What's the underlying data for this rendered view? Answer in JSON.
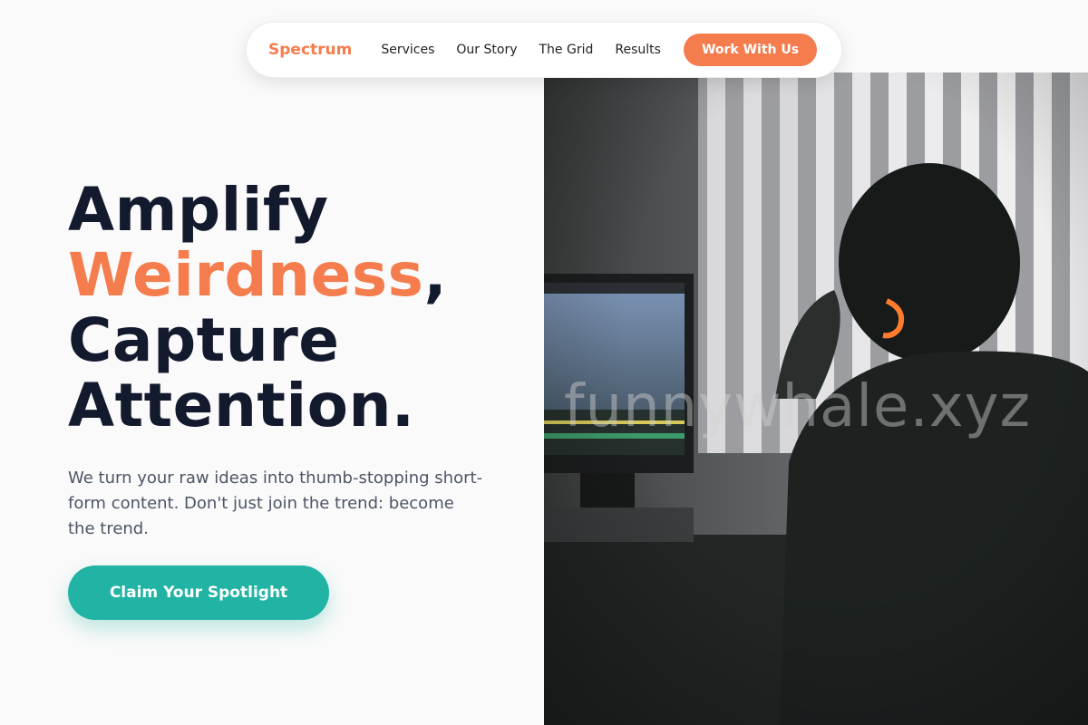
{
  "nav": {
    "brand": "Spectrum",
    "links": [
      "Services",
      "Our Story",
      "The Grid",
      "Results"
    ],
    "cta": "Work With Us"
  },
  "hero": {
    "line1": "Amplify",
    "accent_word": "Weirdness",
    "accent_punct": ",",
    "line3": "Capture",
    "line4": "Attention.",
    "description": "We turn your raw ideas into thumb-stopping short-form content. Don't just join the trend: become the trend.",
    "cta": "Claim Your Spotlight"
  },
  "photo": {
    "watermark": "funnywhale.xyz"
  },
  "colors": {
    "accent": "#f47c4d",
    "teal": "#21b3a3",
    "heading": "#141a2e",
    "text": "#4c5566"
  }
}
